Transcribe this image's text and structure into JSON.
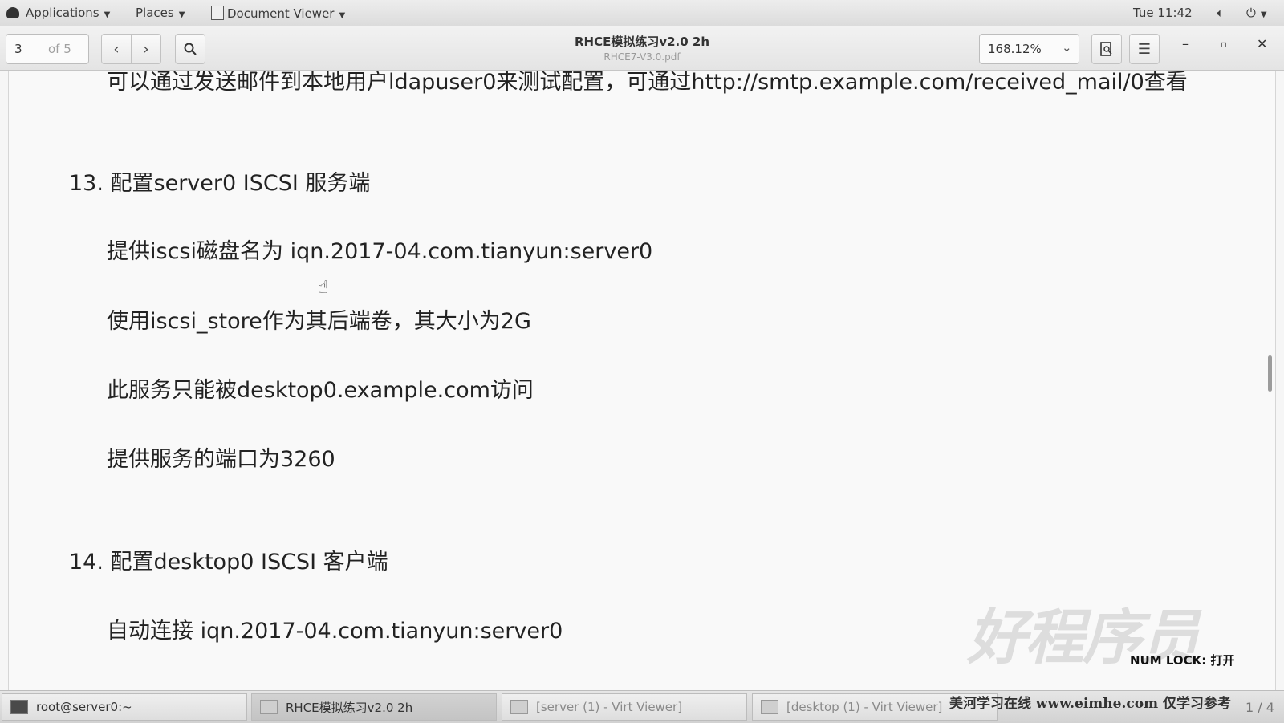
{
  "top_panel": {
    "applications": "Applications",
    "places": "Places",
    "app_name": "Document Viewer",
    "clock": "Tue 11:42"
  },
  "toolbar": {
    "page_number": "3",
    "page_total": "of 5",
    "title": "RHCE模拟练习v2.0 2h",
    "subtitle": "RHCE7-V3.0.pdf",
    "zoom": "168.12%"
  },
  "document": {
    "top_partial": "可以通过发送邮件到本地用户ldapuser0来测试配置，可通过http://smtp.example.com/received_mail/0查看",
    "section13": {
      "heading": "13. 配置server0 ISCSI  服务端",
      "items": [
        "提供iscsi磁盘名为  iqn.2017-04.com.tianyun:server0",
        "使用iscsi_store作为其后端卷，其大小为2G",
        "此服务只能被desktop0.example.com访问",
        "提供服务的端口为3260"
      ]
    },
    "section14": {
      "heading": "14. 配置desktop0 ISCSI  客户端",
      "items": [
        "自动连接  iqn.2017-04.com.tianyun:server0"
      ]
    }
  },
  "overlay": {
    "watermark": "好程序员",
    "numlock": "NUM LOCK: 打开"
  },
  "taskbar": {
    "items": [
      {
        "label": "root@server0:~"
      },
      {
        "label": "RHCE模拟练习v2.0 2h"
      },
      {
        "label": "[server (1) - Virt Viewer]"
      },
      {
        "label": "[desktop (1) - Virt Viewer]"
      }
    ],
    "footer_watermark": "美河学习在线 www.eimhe.com 仅学习参考",
    "workspace": "1 / 4"
  }
}
